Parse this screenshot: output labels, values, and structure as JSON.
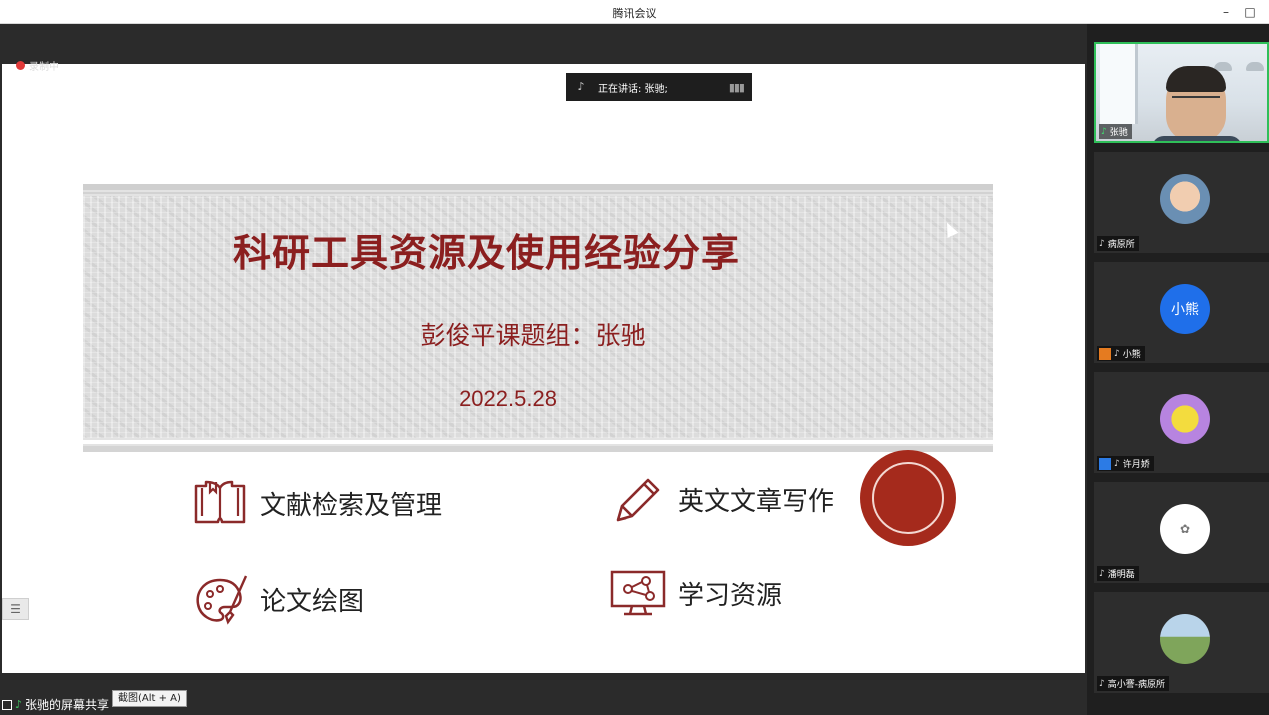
{
  "window": {
    "title": "腾讯会议",
    "min_label": "–",
    "max_label": "□"
  },
  "recording": {
    "label": "录制中"
  },
  "speaking": {
    "text": "正在讲话: 张驰;"
  },
  "slide": {
    "title": "科研工具资源及使用经验分享",
    "author": "彭俊平课题组：张驰",
    "date": "2022.5.28",
    "topics": [
      {
        "label": "文献检索及管理",
        "icon": "book-icon"
      },
      {
        "label": "英文文章写作",
        "icon": "pencil-icon"
      },
      {
        "label": "论文绘图",
        "icon": "palette-icon"
      },
      {
        "label": "学习资源",
        "icon": "monitor-network-icon"
      }
    ],
    "accent_color": "#8b1f1f"
  },
  "share": {
    "label": "张驰的屏幕共享",
    "screenshot_tooltip": "截图(Alt + A)"
  },
  "participants": [
    {
      "name": "张驰",
      "avatar": "video",
      "mic": "on"
    },
    {
      "name": "病原所",
      "avatar": "photo",
      "mic": "muted"
    },
    {
      "name": "小熊",
      "avatar_text": "小熊",
      "avatar": "text",
      "mic": "muted",
      "badge": "host"
    },
    {
      "name": "许月娇",
      "avatar": "cartoon",
      "mic": "muted",
      "badge": "cohost"
    },
    {
      "name": "潘明磊",
      "avatar": "logo",
      "mic": "muted"
    },
    {
      "name": "高小謇-病原所",
      "avatar": "photo",
      "mic": "muted"
    }
  ]
}
